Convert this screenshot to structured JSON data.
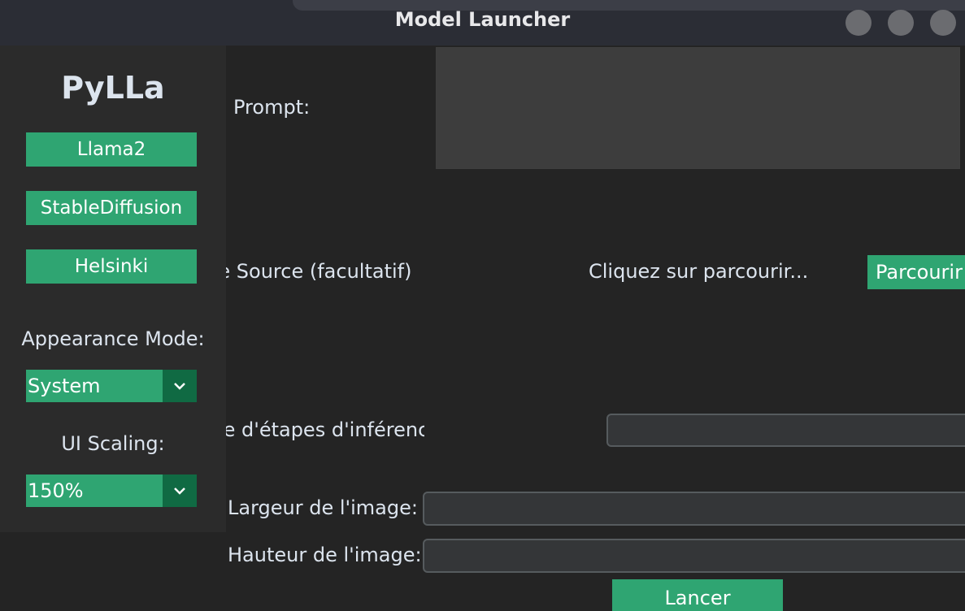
{
  "window": {
    "title": "Model Launcher"
  },
  "sidebar": {
    "logo": "PyLLa",
    "models": [
      {
        "label": "Llama2"
      },
      {
        "label": "StableDiffusion"
      },
      {
        "label": "Helsinki"
      }
    ],
    "appearance_label": "Appearance Mode:",
    "appearance_value": "System",
    "scaling_label": "UI Scaling:",
    "scaling_value": "150%"
  },
  "main": {
    "prompt_label": "Prompt:",
    "prompt_value": "",
    "source_label": "Image Source (facultatif)",
    "source_placeholder": "Cliquez sur parcourir...",
    "browse_label": "Parcourir",
    "steps_label": "Nombre d'étapes d'inférence",
    "width_label": "Largeur de l'image:",
    "height_label": "Hauteur de l'image:",
    "launch_label": "Lancer"
  },
  "colors": {
    "accent": "#2fa572",
    "accent_dark": "#106a43",
    "background": "#242424",
    "sidebar": "#2b2b2b",
    "entry": "#343638"
  },
  "icons": {
    "dropdown": "chevron-down-icon"
  }
}
